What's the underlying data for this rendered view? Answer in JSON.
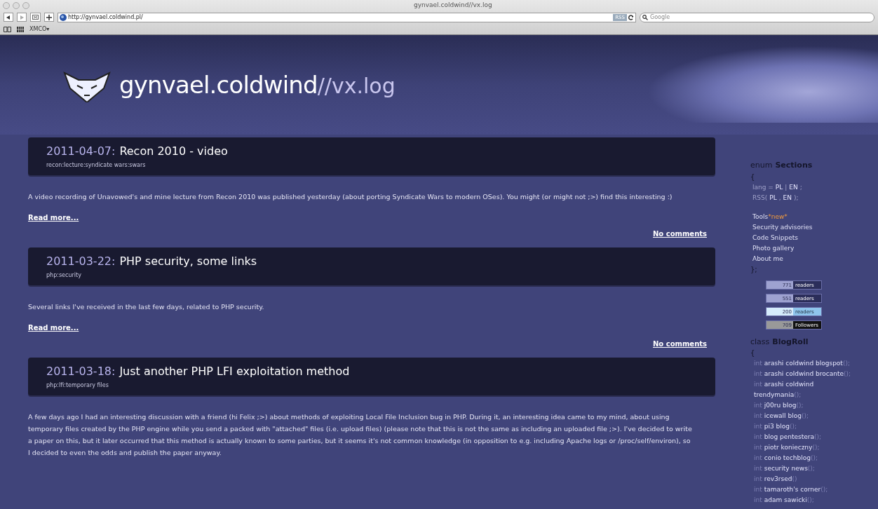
{
  "window": {
    "title": "gynvael.coldwind//vx.log"
  },
  "toolbar": {
    "url": "http://gynvael.coldwind.pl/",
    "rss": "RSS",
    "search_placeholder": "Google"
  },
  "bookmarks": [
    {
      "label": "XMCO▾"
    }
  ],
  "header": {
    "site": "gynvael.coldwind",
    "suffix": "//vx.log"
  },
  "posts": [
    {
      "date": "2011-04-07:",
      "title": "Recon 2010 - video",
      "tags": "recon:lecture:syndicate wars:swars",
      "body": "A video recording of Unavowed's and mine lecture from Recon 2010 was published yesterday (about porting Syndicate Wars to modern OSes). You might (or might not ;>) find this interesting :)",
      "read_more": "Read more...",
      "comments": "No comments"
    },
    {
      "date": "2011-03-22:",
      "title": "PHP security, some links",
      "tags": "php:security",
      "body": "Several links I've received in the last few days, related to PHP security.",
      "read_more": "Read more...",
      "comments": "No comments"
    },
    {
      "date": "2011-03-18:",
      "title": "Just another PHP LFI exploitation method",
      "tags": "php:lfi:temporary files",
      "body": "A few days ago I had an interesting discussion with a friend (hi Felix ;>) about methods of exploiting Local File Inclusion bug in PHP. During it, an interesting idea came to my mind, about using temporary files created by the PHP engine while you send a packed with \"attached\" files (i.e. upload files) (please note that this is not the same as including an uploaded file ;>). I've decided to write a paper on this, but it later occurred that this method is actually known to some parties, but it seems it's not common knowledge (in opposition to e.g. including Apache logs or /proc/self/environ), so I decided to even the odds and publish the paper anyway."
    }
  ],
  "sections": {
    "keyword": "enum",
    "name": "Sections",
    "open": "{",
    "close": "};",
    "lang": {
      "label": "lang =",
      "options": [
        "PL",
        "|",
        "EN",
        ";"
      ]
    },
    "rss": {
      "label": "RSS(",
      "options": [
        "PL",
        ",",
        "EN",
        ");"
      ]
    },
    "links": [
      {
        "label": "Tools",
        "badge": "*new*"
      },
      {
        "label": "Security advisories"
      },
      {
        "label": "Code Snippets"
      },
      {
        "label": "Photo gallery"
      },
      {
        "label": "About me"
      }
    ]
  },
  "badges": [
    {
      "count": "771",
      "label": "readers"
    },
    {
      "count": "551",
      "label": "readers"
    },
    {
      "count": "200",
      "label": "readers"
    },
    {
      "count": "709",
      "label": "Followers"
    }
  ],
  "blogroll": {
    "keyword": "class",
    "name": "BlogRoll",
    "open": "{",
    "items": [
      {
        "type": "int",
        "name": "arashi coldwind blogspot",
        "call": "();"
      },
      {
        "type": "int",
        "name": "arashi coldwind brocante",
        "call": "();"
      },
      {
        "type": "int",
        "name": "arashi coldwind trendymania",
        "call": "();"
      },
      {
        "type": "int",
        "name": "j00ru blog",
        "call": "();"
      },
      {
        "type": "int",
        "name": "icewall blog",
        "call": "();"
      },
      {
        "type": "int",
        "name": "pi3 blog",
        "call": "();"
      },
      {
        "type": "int",
        "name": "blog pentestera",
        "call": "();"
      },
      {
        "type": "int",
        "name": "piotr konieczny",
        "call": "();"
      },
      {
        "type": "int",
        "name": "conio techblog",
        "call": "();"
      },
      {
        "type": "int",
        "name": "security news",
        "call": "();"
      },
      {
        "type": "int",
        "name": "rev3rsed",
        "call": "()"
      },
      {
        "type": "int",
        "name": "tamaroth's corner",
        "call": "();"
      },
      {
        "type": "int",
        "name": "adam sawicki",
        "call": "();"
      }
    ]
  }
}
